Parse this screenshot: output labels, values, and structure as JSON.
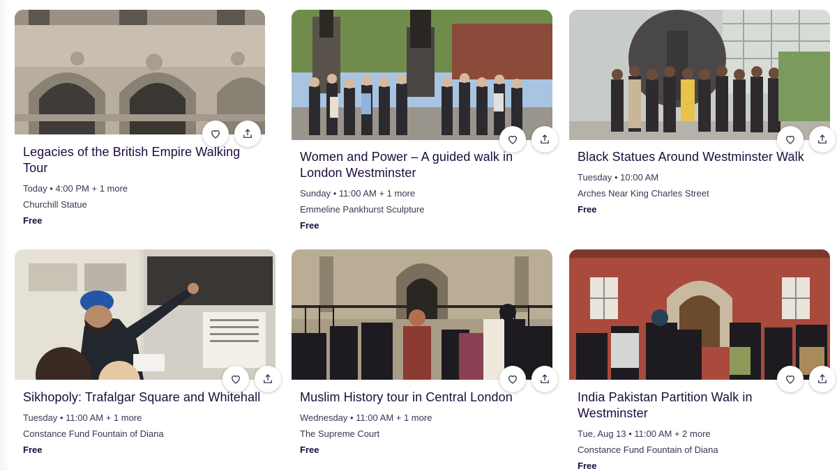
{
  "cards": [
    {
      "title": "Legacies of the British Empire Walking Tour",
      "datetime": "Today • 4:00 PM + 1 more",
      "location": "Churchill Statue",
      "price": "Free",
      "image": "ornate stone building facade with arched windows"
    },
    {
      "title": "Women and Power – A guided walk in London Westminster",
      "datetime": "Sunday • 11:00 AM + 1 more",
      "location": "Emmeline Pankhurst Sculpture",
      "price": "Free",
      "image": "group of people posing in front of statue in park"
    },
    {
      "title": "Black Statues Around Westminster Walk",
      "datetime": "Tuesday • 10:00 AM",
      "location": "Arches Near King Charles Street",
      "price": "Free",
      "image": "group posing in front of large dark bronze statue"
    },
    {
      "title": "Sikhopoly: Trafalgar Square and Whitehall",
      "datetime": "Tuesday • 11:00 AM + 1 more",
      "location": "Constance Fund Fountain of Diana",
      "price": "Free",
      "image": "guide in blue turban pointing at history display board"
    },
    {
      "title": "Muslim History tour in Central London",
      "datetime": "Wednesday • 11:00 AM + 1 more",
      "location": "The Supreme Court",
      "price": "Free",
      "image": "group listening to guide in front of gothic abbey"
    },
    {
      "title": "India Pakistan Partition Walk in Westminster",
      "datetime": "Tue, Aug 13 • 11:00 AM + 2 more",
      "location": "Constance Fund Fountain of Diana",
      "price": "Free",
      "image": "group standing in front of red brick building"
    }
  ],
  "icons": {
    "like": "heart-icon",
    "share": "share-icon"
  },
  "colors": {
    "title": "#1e0a3c",
    "meta": "#39364f"
  }
}
